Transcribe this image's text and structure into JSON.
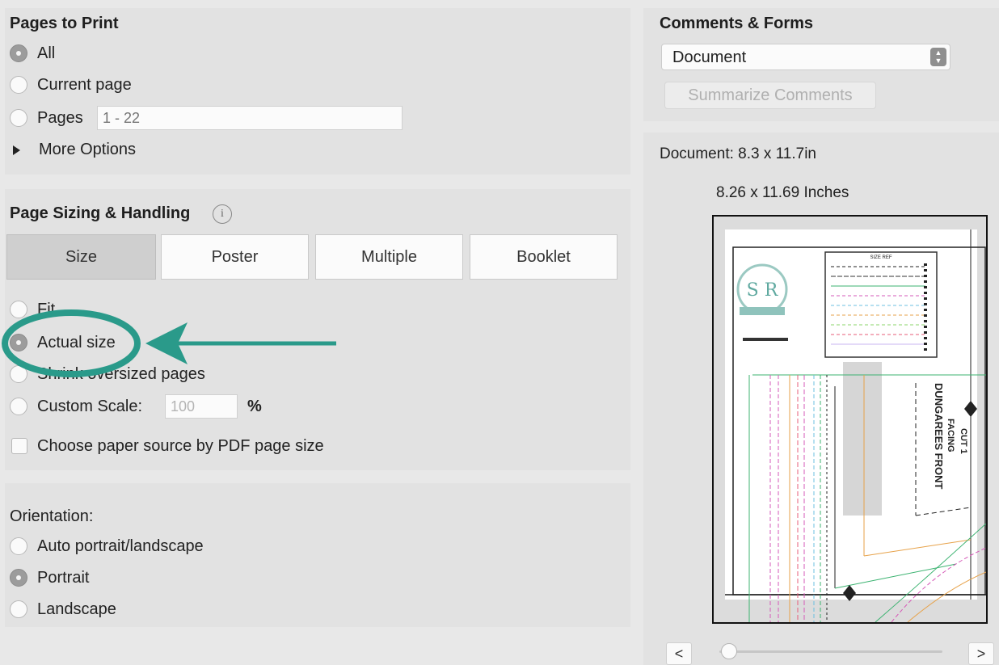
{
  "pages_to_print": {
    "title": "Pages to Print",
    "all_label": "All",
    "current_page_label": "Current page",
    "pages_label": "Pages",
    "pages_range_placeholder": "1 - 22",
    "more_options_label": "More Options",
    "selected": "All"
  },
  "page_sizing": {
    "title": "Page Sizing & Handling",
    "tabs": [
      {
        "label": "Size",
        "active": true
      },
      {
        "label": "Poster",
        "active": false
      },
      {
        "label": "Multiple",
        "active": false
      },
      {
        "label": "Booklet",
        "active": false
      }
    ],
    "fit_label": "Fit",
    "actual_size_label": "Actual size",
    "shrink_label": "Shrink oversized pages",
    "custom_scale_label": "Custom Scale:",
    "custom_scale_value": "100",
    "custom_scale_unit": "%",
    "paper_source_label": "Choose paper source by PDF page size",
    "selected": "Actual size"
  },
  "orientation": {
    "title": "Orientation:",
    "auto_label": "Auto portrait/landscape",
    "portrait_label": "Portrait",
    "landscape_label": "Landscape",
    "selected": "Portrait"
  },
  "comments_forms": {
    "title": "Comments & Forms",
    "select_value": "Document",
    "summarize_button": "Summarize Comments"
  },
  "preview": {
    "document_size": "Document: 8.3 x 11.7in",
    "page_size": "8.26 x 11.69 Inches",
    "prev_label": "<",
    "next_label": ">",
    "page_slider_value": 0,
    "thumb_header": "SIZE REF",
    "thumb_vertical_text": [
      "DUNGAREES FRONT",
      "FACING",
      "CUT 1"
    ]
  },
  "annotation": {
    "color": "#2a9a8a"
  },
  "colors": {
    "background": "#e8e8e8",
    "panel": "#e2e2e2",
    "accent_teal": "#2a9a8a"
  }
}
